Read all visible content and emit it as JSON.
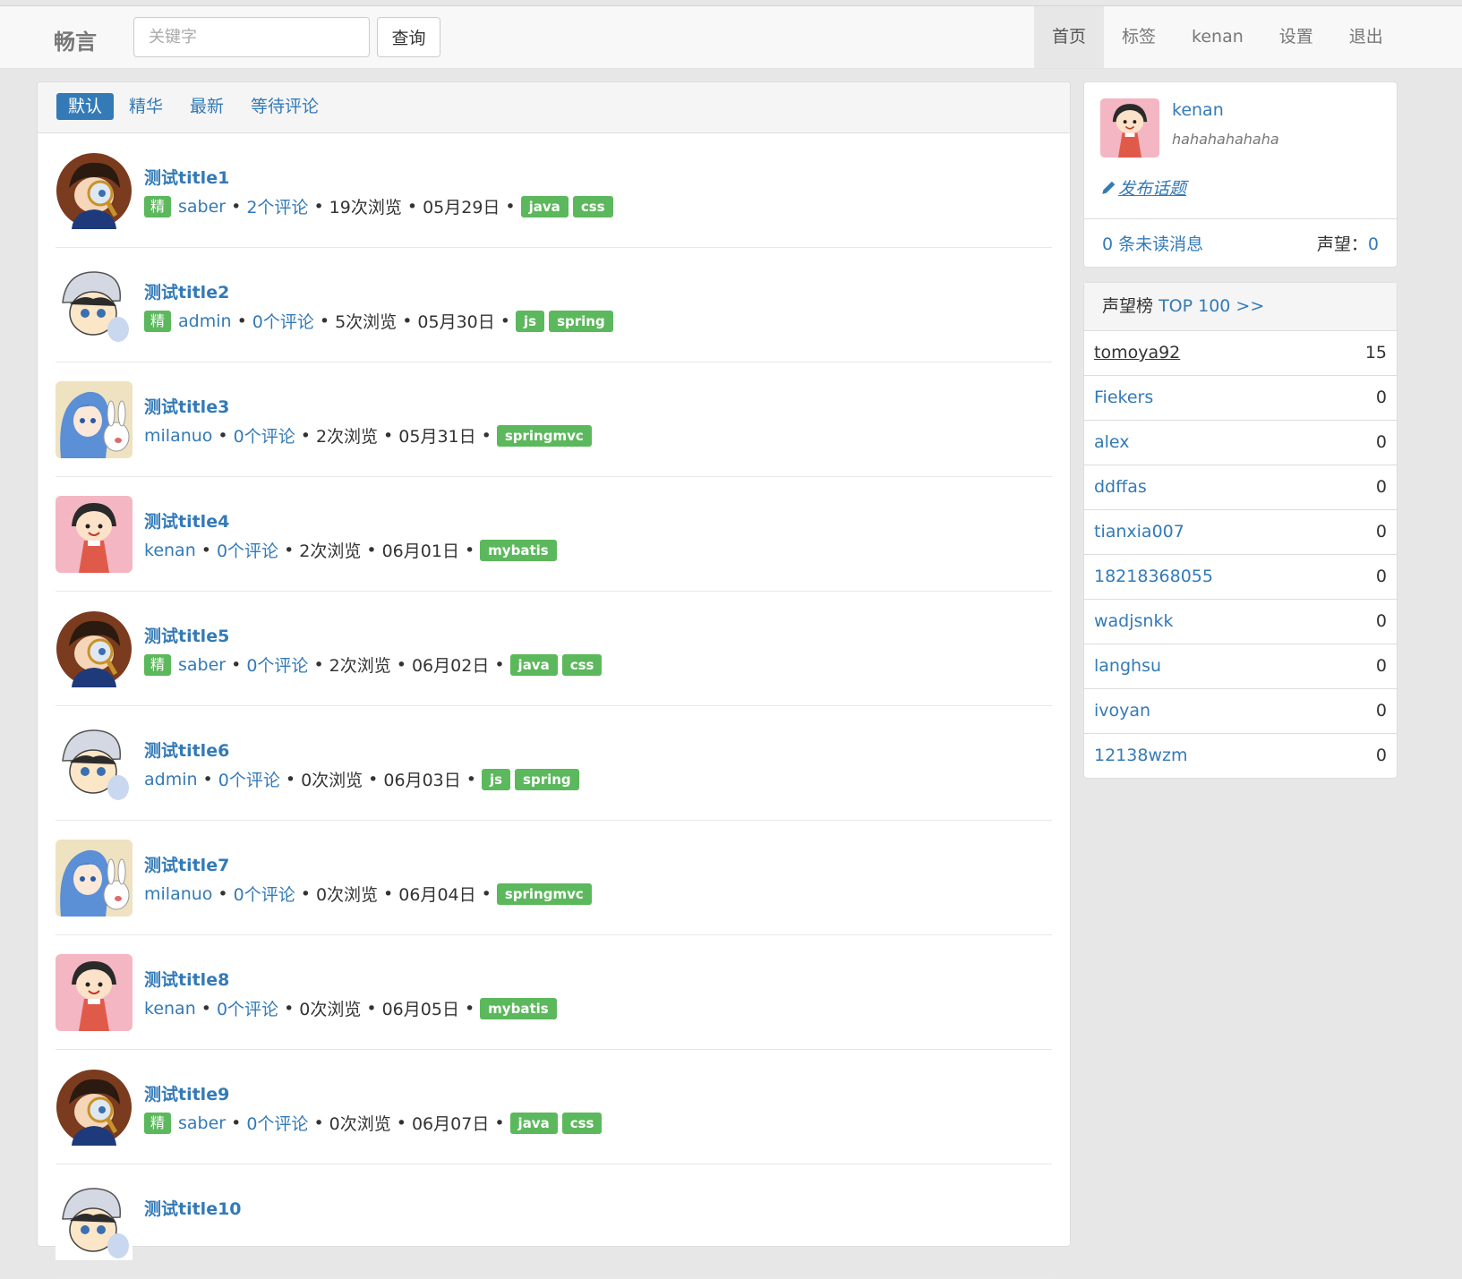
{
  "nav": {
    "brand": "畅言",
    "search_placeholder": "关键字",
    "search_button": "查询",
    "items": [
      "首页",
      "标签",
      "kenan",
      "设置",
      "退出"
    ]
  },
  "tabs": [
    "默认",
    "精华",
    "最新",
    "等待评论"
  ],
  "topics": [
    {
      "title": "测试title1",
      "good": "精",
      "author": "saber",
      "comments": "2个评论",
      "views": "19次浏览",
      "date": "05月29日",
      "tags": [
        "java",
        "css"
      ],
      "avatar": "conan"
    },
    {
      "title": "测试title2",
      "good": "精",
      "author": "admin",
      "comments": "0个评论",
      "views": "5次浏览",
      "date": "05月30日",
      "tags": [
        "js",
        "spring"
      ],
      "avatar": "capboy"
    },
    {
      "title": "测试title3",
      "good": "",
      "author": "milanuo",
      "comments": "0个评论",
      "views": "2次浏览",
      "date": "05月31日",
      "tags": [
        "springmvc"
      ],
      "avatar": "bluegirl"
    },
    {
      "title": "测试title4",
      "good": "",
      "author": "kenan",
      "comments": "0个评论",
      "views": "2次浏览",
      "date": "06月01日",
      "tags": [
        "mybatis"
      ],
      "avatar": "maruko"
    },
    {
      "title": "测试title5",
      "good": "精",
      "author": "saber",
      "comments": "0个评论",
      "views": "2次浏览",
      "date": "06月02日",
      "tags": [
        "java",
        "css"
      ],
      "avatar": "conan"
    },
    {
      "title": "测试title6",
      "good": "",
      "author": "admin",
      "comments": "0个评论",
      "views": "0次浏览",
      "date": "06月03日",
      "tags": [
        "js",
        "spring"
      ],
      "avatar": "capboy"
    },
    {
      "title": "测试title7",
      "good": "",
      "author": "milanuo",
      "comments": "0个评论",
      "views": "0次浏览",
      "date": "06月04日",
      "tags": [
        "springmvc"
      ],
      "avatar": "bluegirl"
    },
    {
      "title": "测试title8",
      "good": "",
      "author": "kenan",
      "comments": "0个评论",
      "views": "0次浏览",
      "date": "06月05日",
      "tags": [
        "mybatis"
      ],
      "avatar": "maruko"
    },
    {
      "title": "测试title9",
      "good": "精",
      "author": "saber",
      "comments": "0个评论",
      "views": "0次浏览",
      "date": "06月07日",
      "tags": [
        "java",
        "css"
      ],
      "avatar": "conan"
    },
    {
      "title": "测试title10",
      "good": "",
      "author": "",
      "comments": "",
      "views": "",
      "date": "",
      "tags": [],
      "avatar": "capboy"
    }
  ],
  "user": {
    "name": "kenan",
    "signature": "hahahahahaha",
    "publish": "发布话题",
    "unread": "0 条未读消息",
    "reputation_label": "声望：",
    "reputation": "0"
  },
  "rank": {
    "label": "声望榜",
    "link": "TOP 100 >>",
    "rows": [
      {
        "name": "tomoya92",
        "score": "15"
      },
      {
        "name": "Fiekers",
        "score": "0"
      },
      {
        "name": "alex",
        "score": "0"
      },
      {
        "name": "ddffas",
        "score": "0"
      },
      {
        "name": "tianxia007",
        "score": "0"
      },
      {
        "name": "18218368055",
        "score": "0"
      },
      {
        "name": "wadjsnkk",
        "score": "0"
      },
      {
        "name": "langhsu",
        "score": "0"
      },
      {
        "name": "ivoyan",
        "score": "0"
      },
      {
        "name": "12138wzm",
        "score": "0"
      }
    ]
  },
  "colors": {
    "primary": "#337ab7",
    "tag": "#5cb85c",
    "navbar": "#f8f8f8",
    "background": "#e7e7e7"
  }
}
